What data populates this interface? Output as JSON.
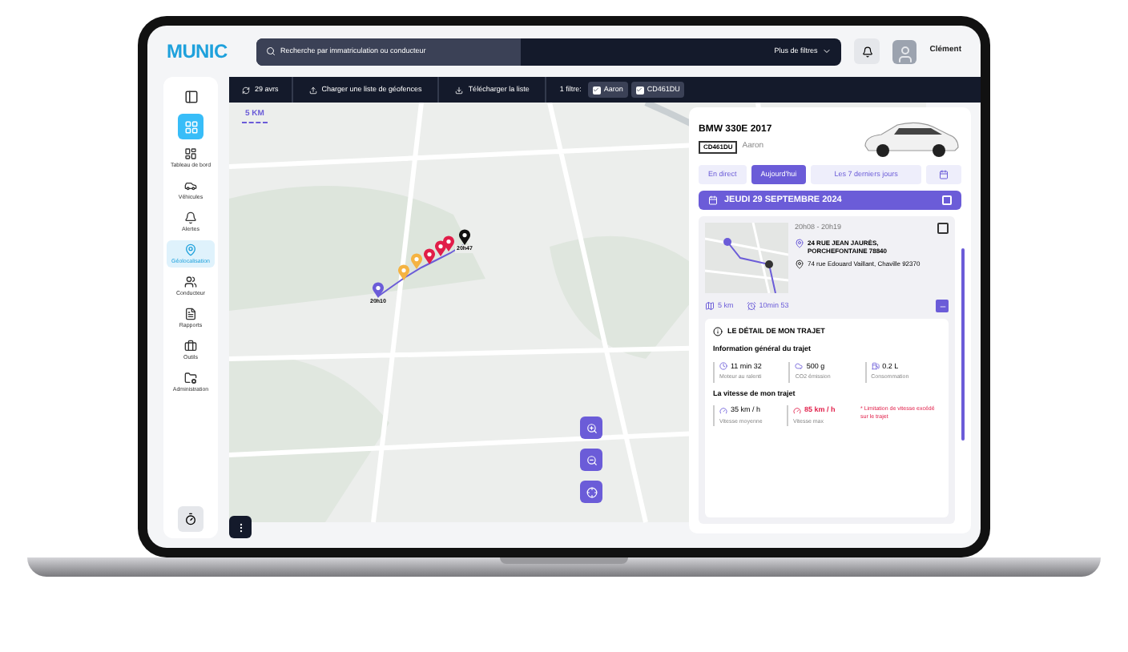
{
  "header": {
    "logo": "MUNIC",
    "search": {
      "placeholder": "Recherche par immatriculation ou conducteur"
    },
    "filters_button": "Plus de filtres",
    "user": "Clément"
  },
  "sidebar": {
    "items": [
      {
        "kind": "toggle",
        "selected": false
      },
      {
        "kind": "apps",
        "selected": true
      },
      {
        "label": "Tableau de bord",
        "kind": "nav",
        "selected": false
      },
      {
        "label": "Véhicules",
        "kind": "nav",
        "selected": false
      },
      {
        "label": "Alertes",
        "kind": "nav",
        "selected": false
      },
      {
        "label": "Géolocalisation",
        "kind": "nav",
        "selected": true
      },
      {
        "label": "Conducteur",
        "kind": "nav",
        "selected": false
      },
      {
        "label": "Rapports",
        "kind": "nav",
        "selected": false
      },
      {
        "label": "Outils",
        "kind": "nav",
        "selected": false
      },
      {
        "label": "Administration",
        "kind": "nav",
        "selected": false
      }
    ]
  },
  "toolbar": {
    "date": "29 avrs",
    "upload": "Charger une liste de géofences",
    "download": "Télécharger la liste",
    "filter_label": "1 filtre:",
    "chips": [
      {
        "label": "Aaron",
        "checked": true
      },
      {
        "label": "CD461DU",
        "checked": true
      }
    ]
  },
  "map": {
    "scale": "5 KM",
    "start_time": "20h10",
    "end_time": "20h47"
  },
  "panel": {
    "title": "BMW 330E 2017",
    "plate": "CD461DU",
    "driver": "Aaron",
    "tabs": [
      {
        "label": "En direct",
        "selected": false
      },
      {
        "label": "Aujourd'hui",
        "selected": true
      },
      {
        "label": "Les 7 derniers jours",
        "selected": false
      }
    ],
    "date": "JEUDI 29 SEPTEMBRE 2024",
    "date_checked": false,
    "trip": {
      "time": "20h08 - 20h19",
      "from": "24 RUE JEAN JAURÈS, PORCHEFONTAINE 78840",
      "to": "74 rue Edouard Vaillant, Chaville 92370",
      "distance": "5 km",
      "duration": "10min 53",
      "checked": false,
      "expanded": true
    },
    "detail": {
      "title": "LE DÉTAIL DE MON TRAJET",
      "general_title": "Information général du trajet",
      "general": [
        {
          "value": "11 min 32",
          "label": "Moteur au ralenti",
          "alert": false
        },
        {
          "value": "500 g",
          "label": "CO2 émission",
          "alert": false
        },
        {
          "value": "0.2 L",
          "label": "Consommation",
          "alert": false
        }
      ],
      "speed_title": "La vitesse de mon trajet",
      "speed": [
        {
          "value": "35 km / h",
          "label": "Vitesse moyenne",
          "alert": false
        },
        {
          "value": "85 km / h",
          "label": "Vitesse max",
          "alert": true
        }
      ],
      "speed_note": "* Limitation de vitesse excédé sur le trajet"
    }
  }
}
